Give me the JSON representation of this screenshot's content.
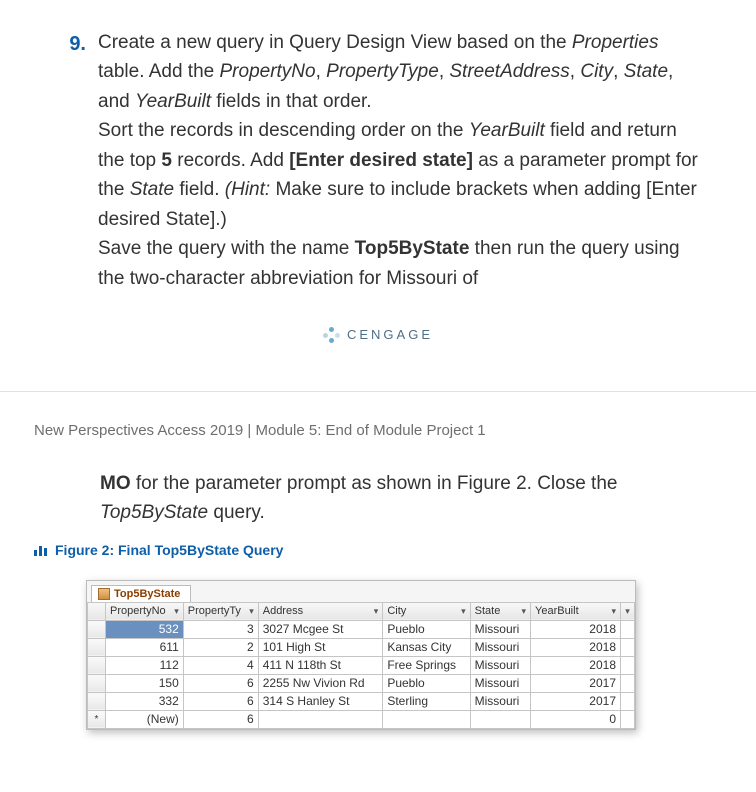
{
  "step": {
    "number": "9.",
    "p1_a": "Create a new query in Query Design View based on the ",
    "p1_table": "Properties",
    "p1_b": " table. Add the ",
    "f1": "PropertyNo",
    "f2": "PropertyType",
    "f3": "StreetAddress",
    "f4": "City",
    "f5": "State",
    "f6": "YearBuilt",
    "p1_c": " fields in that order.",
    "p2_a": "Sort the records in descending order on the ",
    "p2_b": " field and return the top ",
    "top_n": "5",
    "p2_c": " records. Add ",
    "param": "[Enter desired state]",
    "p2_d": " as a parameter prompt for the ",
    "p2_e": " field. ",
    "hint_lead": "(Hint:",
    "hint_body": " Make sure to include brackets when adding [Enter desired State].)",
    "p3_a": "Save the query with the name ",
    "qname": "Top5ByState",
    "p3_b": " then run the query using the two-character abbreviation for Missouri of"
  },
  "brand": "CENGAGE",
  "breadcrumb": "New Perspectives Access 2019 | Module 5: End of Module Project 1",
  "cont": {
    "mo": "MO",
    "a": " for the parameter prompt as shown in Figure 2. Close the ",
    "q": "Top5ByState",
    "b": " query."
  },
  "figure_label": "Figure 2: Final Top5ByState Query",
  "datasheet": {
    "tab": "Top5ByState",
    "headers": [
      "PropertyNo",
      "PropertyTy",
      "Address",
      "City",
      "State",
      "YearBuilt"
    ],
    "rows": [
      {
        "sel": "",
        "pn": "532",
        "pt": "3",
        "addr": "3027 Mcgee St",
        "city": "Pueblo",
        "state": "Missouri",
        "yb": "2018",
        "active": true
      },
      {
        "sel": "",
        "pn": "611",
        "pt": "2",
        "addr": "101 High St",
        "city": "Kansas City",
        "state": "Missouri",
        "yb": "2018",
        "active": false
      },
      {
        "sel": "",
        "pn": "112",
        "pt": "4",
        "addr": "411 N 118th St",
        "city": "Free Springs",
        "state": "Missouri",
        "yb": "2018",
        "active": false
      },
      {
        "sel": "",
        "pn": "150",
        "pt": "6",
        "addr": "2255 Nw Vivion Rd",
        "city": "Pueblo",
        "state": "Missouri",
        "yb": "2017",
        "active": false
      },
      {
        "sel": "",
        "pn": "332",
        "pt": "6",
        "addr": "314 S Hanley St",
        "city": "Sterling",
        "state": "Missouri",
        "yb": "2017",
        "active": false
      }
    ],
    "new_row": {
      "sel": "*",
      "pn": "(New)",
      "pt": "6",
      "addr": "",
      "city": "",
      "state": "",
      "yb": "0"
    }
  }
}
